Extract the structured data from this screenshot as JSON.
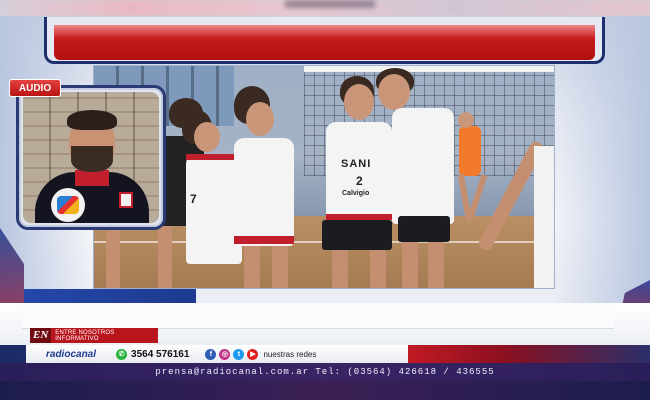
{
  "overlay": {
    "audio_label": "AUDIO"
  },
  "lower_third": {
    "logo": "EN",
    "program": "ENTRE NOSOTROS INFORMATIVO"
  },
  "info_bar": {
    "brand_part1": "radio",
    "brand_part2": "canal",
    "whatsapp": "3564 576161",
    "social_label": "nuestras redes",
    "social_icons": [
      "facebook-icon",
      "instagram-icon",
      "twitter-icon",
      "youtube-icon"
    ]
  },
  "contact": {
    "text": "prensa@radiocanal.com.ar  Tel: (03564) 426618 / 436555"
  },
  "video": {
    "shirt_text": "SANI",
    "shirt_number": "2",
    "sponsor": "Calvigio"
  },
  "colors": {
    "brand_red": "#c41a1a",
    "brand_blue": "#1e2f6e",
    "whatsapp_green": "#27b43e"
  }
}
